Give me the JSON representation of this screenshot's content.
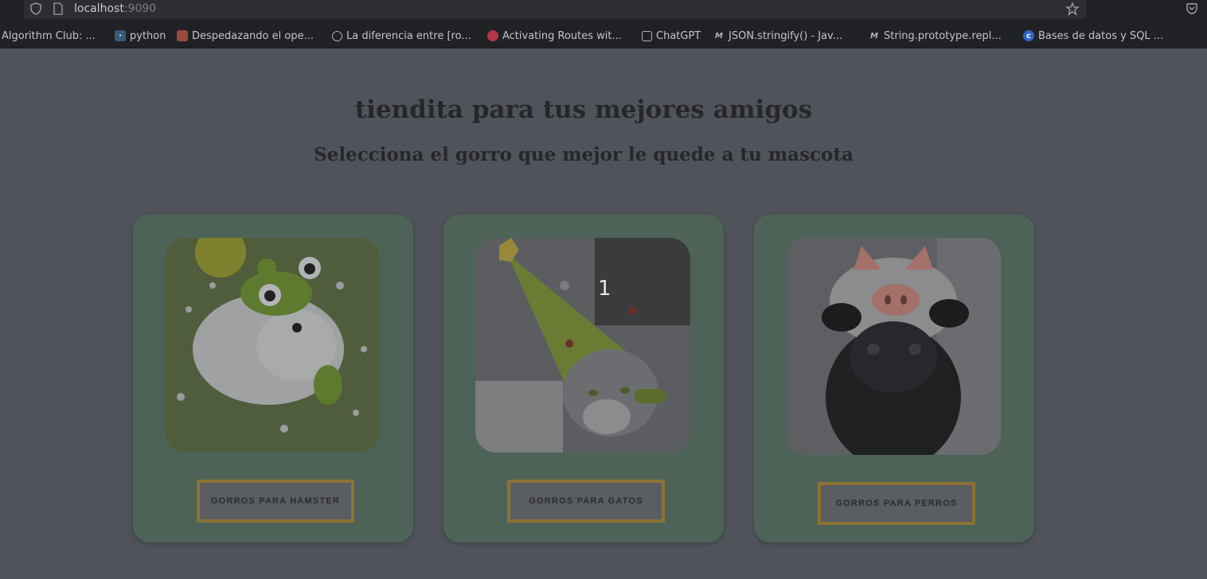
{
  "browser": {
    "url_host": "localhost",
    "url_port": ":9090",
    "bookmarks": [
      {
        "label": "Algorithm Club: ...",
        "icon": "globe-icon"
      },
      {
        "label": "python",
        "icon": "python-icon"
      },
      {
        "label": "Despedazando el ope...",
        "icon": "site-icon"
      },
      {
        "label": "La diferencia entre [ro...",
        "icon": "globe-icon"
      },
      {
        "label": "Activating Routes wit...",
        "icon": "site-icon"
      },
      {
        "label": "ChatGPT",
        "icon": "chatgpt-icon"
      },
      {
        "label": "JSON.stringify() - Jav...",
        "icon": "mdn-icon"
      },
      {
        "label": "String.prototype.repl...",
        "icon": "mdn-icon"
      },
      {
        "label": "Bases de datos y SQL ...",
        "icon": "site-icon"
      }
    ]
  },
  "page": {
    "title": "tiendita para tus mejores amigos",
    "subtitle": "Selecciona el gorro que mejor le quede a tu mascota",
    "overlay_badge": "1"
  },
  "cards": [
    {
      "button_label": "GORROS PARA HAMSTER",
      "image": "hamster with frog hat"
    },
    {
      "button_label": "GORROS PARA GATOS",
      "image": "cat with tree hat"
    },
    {
      "button_label": "GORROS PARA PERROS",
      "image": "pug with pig hat"
    }
  ],
  "colors": {
    "card_bg": "#4e6357",
    "button_border": "#8c7235",
    "page_bg": "#50545a"
  }
}
